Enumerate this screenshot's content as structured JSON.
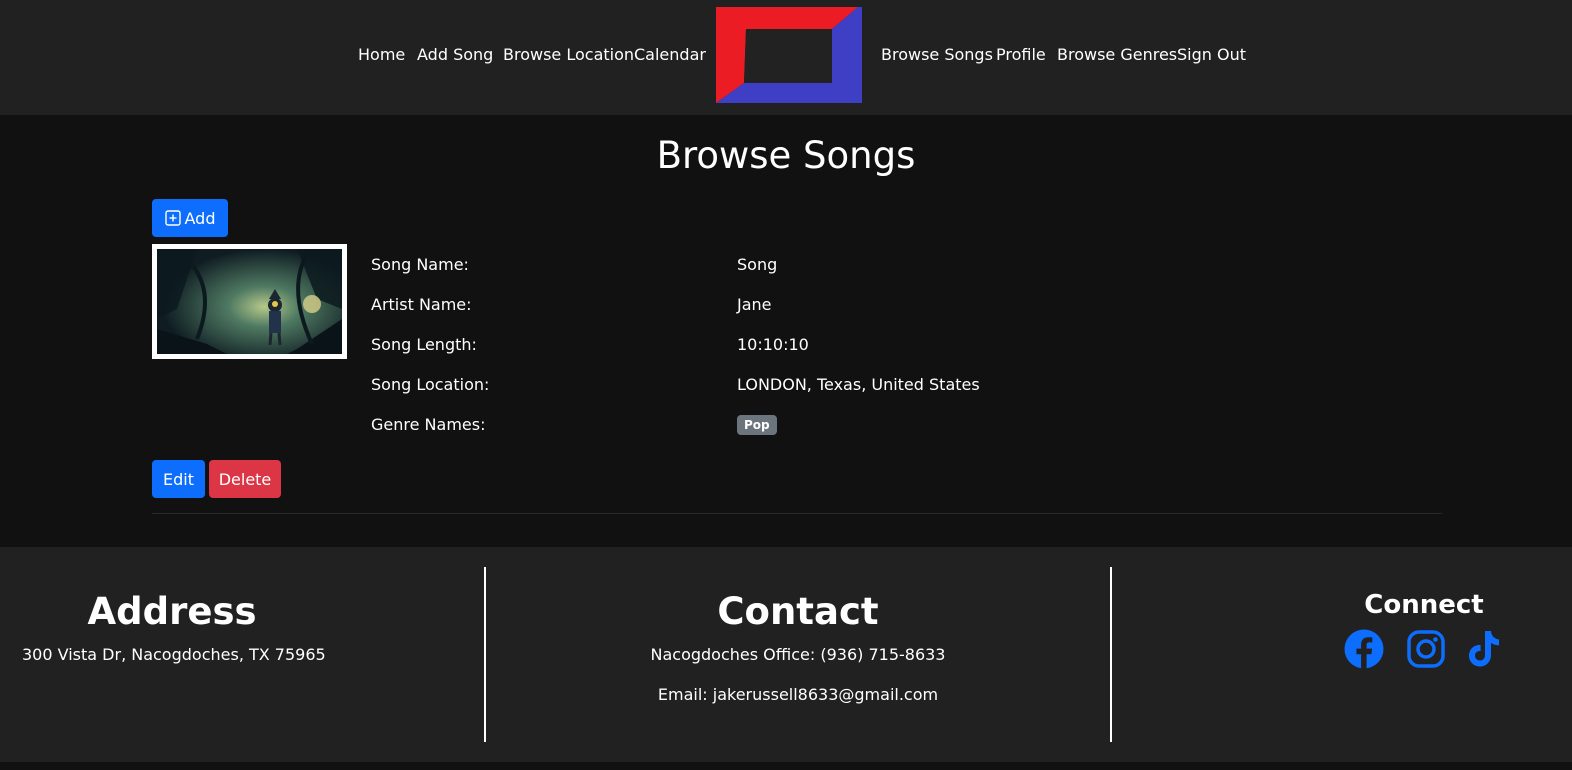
{
  "nav": {
    "left": [
      "Home",
      "Add Song",
      "Browse Location",
      "Calendar"
    ],
    "right": [
      "Browse Songs",
      "Profile",
      "Browse Genres",
      "Sign Out"
    ]
  },
  "page": {
    "title": "Browse Songs"
  },
  "toolbar": {
    "add_label": "Add"
  },
  "song": {
    "fields": [
      {
        "label": "Song Name:",
        "value": "Song"
      },
      {
        "label": "Artist Name:",
        "value": "Jane"
      },
      {
        "label": "Song Length:",
        "value": "10:10:10"
      },
      {
        "label": "Song Location:",
        "value": "LONDON, Texas, United States"
      },
      {
        "label": "Genre Names:",
        "value": ""
      }
    ],
    "genres": [
      "Pop"
    ],
    "edit_label": "Edit",
    "delete_label": "Delete"
  },
  "footer": {
    "address": {
      "heading": "Address",
      "text": "300 Vista Dr, Nacogdoches, TX 75965"
    },
    "contact": {
      "heading": "Contact",
      "phone": "Nacogdoches Office: (936) 715-8633",
      "email": "Email: jakerussell8633@gmail.com"
    },
    "connect": {
      "heading": "Connect",
      "icons": [
        "facebook-icon",
        "instagram-icon",
        "tiktok-icon"
      ]
    }
  },
  "colors": {
    "primary": "#0d6efd",
    "danger": "#dc3545",
    "badge": "#6c757d",
    "nav_bg": "#212121",
    "page_bg": "#111111",
    "logo_red": "#ec1c24",
    "logo_blue": "#3f3fc6"
  }
}
